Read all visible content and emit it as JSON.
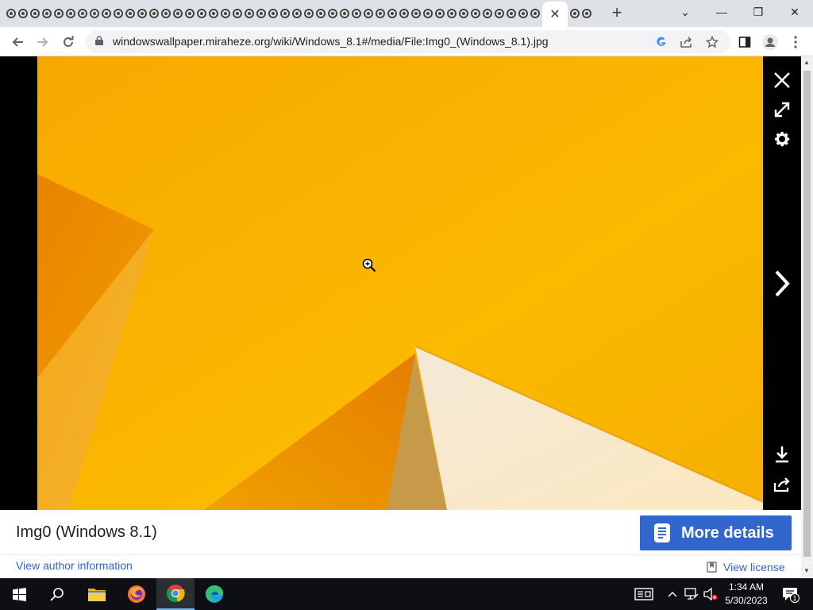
{
  "browser": {
    "active_tab_close": "✕",
    "new_tab": "+",
    "url": "windowswallpaper.miraheze.org/wiki/Windows_8.1#/media/File:Img0_(Windows_8.1).jpg",
    "window_controls": {
      "list": "⌄",
      "minimize": "—",
      "restore": "❐",
      "close": "✕"
    }
  },
  "viewer": {
    "title": "Img0 (Windows 8.1)",
    "more_details_label": "More details",
    "author_link": "View author information",
    "license_link": "View license"
  },
  "taskbar": {
    "time": "1:34 AM",
    "date": "5/30/2023",
    "notification_count": "1"
  },
  "colors": {
    "accent": "#3366cc",
    "photo_yellow": "#f9b800",
    "photo_orange": "#ee8a00",
    "taskbar": "#0d0f12"
  }
}
